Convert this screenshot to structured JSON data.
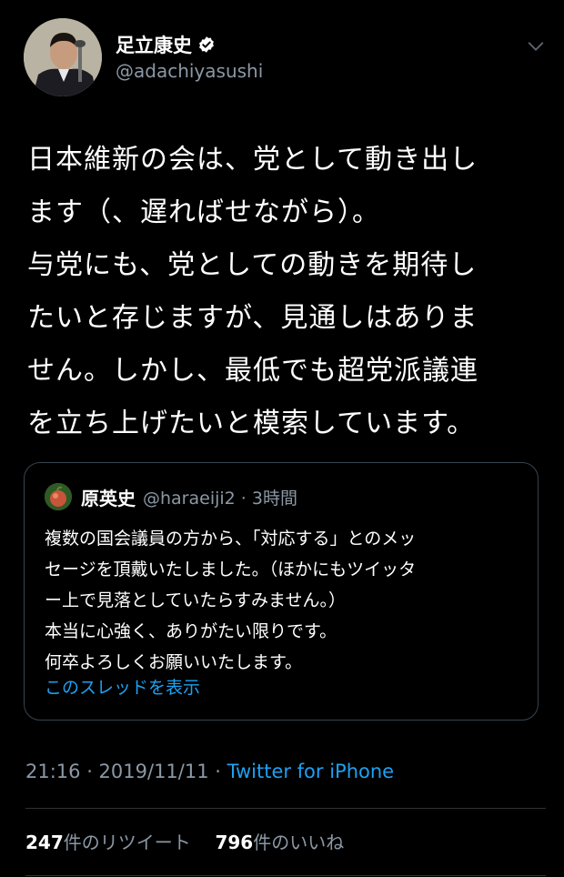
{
  "author": {
    "name": "足立康史",
    "handle": "@adachiyasushi"
  },
  "tweet": {
    "text": "日本維新の会は、党として動き出し\nます（、遅ればせながら）。\n与党にも、党としての動きを期待し\nたいと存じますが、見通しはありま\nせん。しかし、最低でも超党派議連\nを立ち上げたいと模索しています。"
  },
  "quote": {
    "name": "原英史",
    "handle_time": "@haraeiji2 · 3時間",
    "text": "複数の国会議員の方から、「対応する」とのメッ\nセージを頂戴いたしました。（ほかにもツイッタ\nー上で見落としていたらすみません。）\n本当に心強く、ありがたい限りです。\n何卒よろしくお願いいたします。",
    "thread_link": "このスレッドを表示"
  },
  "meta": {
    "datetime": "21:16 · 2019/11/11 · ",
    "source": "Twitter for iPhone"
  },
  "stats": {
    "retweets_count": "247",
    "retweets_label": "件のリツイート",
    "likes_count": "796",
    "likes_label": "件のいいね"
  },
  "colors": {
    "background": "#000000",
    "secondary_text": "#8b98a5",
    "accent": "#1da1f2",
    "border": "#38444d"
  },
  "icons": [
    "verified-icon",
    "chevron-down-icon"
  ]
}
